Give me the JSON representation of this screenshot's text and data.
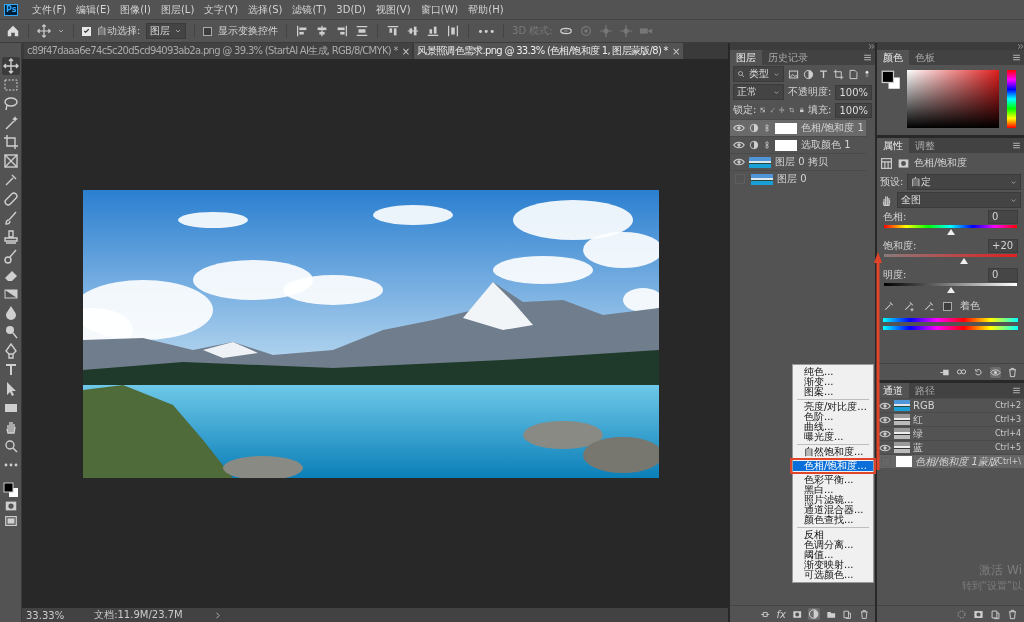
{
  "menu_bar": {
    "logo": "Ps",
    "items": [
      "文件(F)",
      "编辑(E)",
      "图像(I)",
      "图层(L)",
      "文字(Y)",
      "选择(S)",
      "滤镜(T)",
      "3D(D)",
      "视图(V)",
      "窗口(W)",
      "帮助(H)"
    ]
  },
  "options_bar": {
    "auto_select": {
      "label": "自动选择:",
      "checked": true
    },
    "auto_select_target": "图层",
    "show_transform": {
      "label": "显示变换控件",
      "checked": false
    },
    "more": "•••",
    "mode_3d": {
      "label": "3D 模式:",
      "disabled": true
    }
  },
  "document_tabs": [
    {
      "title": "c89f47daaa6e74c5c20d5cd94093ab2a.png @ 39.3% (StartAI AI生成, RGB/8/CMYK) *",
      "close": "×",
      "selected": false
    },
    {
      "title": "风景照调色需求.png @ 33.3% (色相/饱和度 1, 图层蒙版/8) *",
      "close": "×",
      "selected": true
    }
  ],
  "tools": [
    {
      "kind": "move",
      "selected": true
    },
    {
      "kind": "marquee",
      "selected": false
    },
    {
      "kind": "lasso",
      "selected": false
    },
    {
      "kind": "wand",
      "selected": false
    },
    {
      "kind": "crop",
      "selected": false
    },
    {
      "kind": "frame",
      "selected": false
    },
    {
      "kind": "eyedropper",
      "selected": false
    },
    {
      "kind": "healing",
      "selected": false
    },
    {
      "kind": "brush",
      "selected": false
    },
    {
      "kind": "stamp",
      "selected": false
    },
    {
      "kind": "history",
      "selected": false
    },
    {
      "kind": "eraser",
      "selected": false
    },
    {
      "kind": "bucket",
      "selected": false
    },
    {
      "kind": "drop",
      "selected": false
    },
    {
      "kind": "dodge",
      "selected": false
    },
    {
      "kind": "pen",
      "selected": false
    },
    {
      "kind": "type",
      "selected": false
    },
    {
      "kind": "select",
      "selected": false
    },
    {
      "kind": "rect",
      "selected": false
    },
    {
      "kind": "hand",
      "selected": false
    },
    {
      "kind": "zoom",
      "selected": false
    },
    {
      "kind": "more",
      "selected": false
    }
  ],
  "status_bar": {
    "zoom": "33.33%",
    "document_size": "文档:11.9M/23.7M"
  },
  "layers_panel": {
    "tabs": [
      {
        "label": "图层",
        "selected": true
      },
      {
        "label": "历史记录",
        "selected": false
      }
    ],
    "filter": "类型",
    "blend_mode": "正常",
    "opacity_label": "不透明度:",
    "opacity": "100%",
    "lock_label": "锁定:",
    "fill_label": "填充:",
    "fill": "100%",
    "layers": [
      {
        "name": "色相/饱和度 1",
        "kind": "adjustment",
        "visible": true,
        "selected": true
      },
      {
        "name": "选取颜色 1",
        "kind": "adjustment",
        "visible": true,
        "selected": false
      },
      {
        "name": "图层 0 拷贝",
        "kind": "image",
        "visible": true,
        "selected": false
      },
      {
        "name": "图层 0",
        "kind": "image",
        "visible": false,
        "selected": false
      }
    ],
    "fx_label": "fx"
  },
  "color_panel": {
    "tabs": [
      {
        "label": "颜色",
        "selected": true
      },
      {
        "label": "色板",
        "selected": false
      }
    ]
  },
  "properties_panel": {
    "tabs": [
      {
        "label": "属性",
        "selected": true
      },
      {
        "label": "调整",
        "selected": false
      }
    ],
    "title": "色相/饱和度",
    "preset_label": "预设:",
    "preset": "自定",
    "range": "全图",
    "sliders": [
      {
        "kind": "hue",
        "label": "色相:",
        "value": "0",
        "level": 0.5
      },
      {
        "kind": "saturation",
        "label": "饱和度:",
        "value": "+20",
        "level": 0.6
      },
      {
        "kind": "lightness",
        "label": "明度:",
        "value": "0",
        "level": 0.5
      }
    ],
    "colorize": {
      "label": "着色",
      "checked": false
    }
  },
  "channels_panel": {
    "tabs": [
      {
        "label": "通道",
        "selected": true
      },
      {
        "label": "路径",
        "selected": false
      }
    ],
    "channels": [
      {
        "kind": "composite",
        "name": "RGB",
        "shortcut": "Ctrl+2",
        "visible": true,
        "selected": false
      },
      {
        "kind": "single",
        "name": "红",
        "shortcut": "Ctrl+3",
        "visible": true,
        "selected": false
      },
      {
        "kind": "single",
        "name": "绿",
        "shortcut": "Ctrl+4",
        "visible": true,
        "selected": false
      },
      {
        "kind": "single",
        "name": "蓝",
        "shortcut": "Ctrl+5",
        "visible": true,
        "selected": false
      },
      {
        "kind": "mask",
        "name": "色相/饱和度 1蒙版",
        "shortcut": "Ctrl+\\",
        "visible": false,
        "selected": true
      }
    ]
  },
  "adjustment_menu": {
    "groups": [
      [
        {
          "label": "纯色...",
          "selected": false
        },
        {
          "label": "渐变...",
          "selected": false
        },
        {
          "label": "图案...",
          "selected": false
        }
      ],
      [
        {
          "label": "亮度/对比度...",
          "selected": false
        },
        {
          "label": "色阶...",
          "selected": false
        },
        {
          "label": "曲线...",
          "selected": false
        },
        {
          "label": "曝光度...",
          "selected": false
        }
      ],
      [
        {
          "label": "自然饱和度...",
          "selected": false
        },
        {
          "label": "色相/饱和度...",
          "selected": true
        },
        {
          "label": "色彩平衡...",
          "selected": false
        },
        {
          "label": "黑白...",
          "selected": false
        },
        {
          "label": "照片滤镜...",
          "selected": false
        },
        {
          "label": "通道混合器...",
          "selected": false
        },
        {
          "label": "颜色查找...",
          "selected": false
        }
      ],
      [
        {
          "label": "反相",
          "selected": false
        },
        {
          "label": "色调分离...",
          "selected": false
        },
        {
          "label": "阈值...",
          "selected": false
        },
        {
          "label": "渐变映射...",
          "selected": false
        },
        {
          "label": "可选颜色...",
          "selected": false
        }
      ]
    ]
  },
  "system_notice": {
    "title": "激活 Wi",
    "subtitle": "转到“设置”以"
  }
}
